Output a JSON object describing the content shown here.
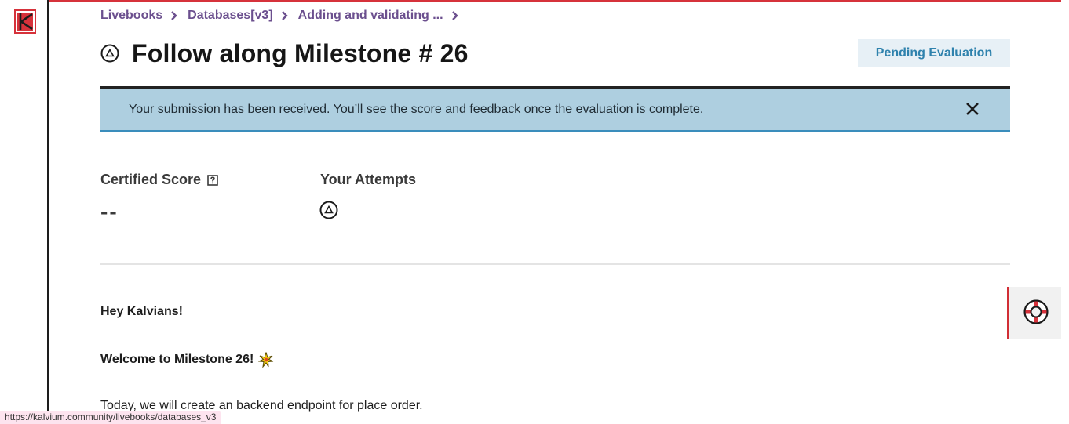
{
  "breadcrumb": {
    "items": [
      "Livebooks",
      "Databases[v3]",
      "Adding and validating ..."
    ]
  },
  "header": {
    "title": "Follow along Milestone # 26",
    "status": "Pending Evaluation"
  },
  "alert": {
    "message": "Your submission has been received. You’ll see the score and feedback once the evaluation is complete."
  },
  "score": {
    "label": "Certified Score",
    "value": "--"
  },
  "attempts": {
    "label": "Your Attempts"
  },
  "body": {
    "greeting": "Hey Kalvians!",
    "welcome": "Welcome to Milestone 26!",
    "intro": "Today, we will create an backend endpoint for place order."
  },
  "status_bar": {
    "url": "https://kalvium.community/livebooks/databases_v3"
  },
  "colors": {
    "accent_red": "#d6323b",
    "breadcrumb_purple": "#6b4f8e",
    "status_blue": "#2f82ad",
    "alert_bg": "#aecfe0"
  },
  "icons": {
    "logo": "kalvium-logo-icon",
    "title_status": "pending-triangle-icon",
    "alert_close": "close-icon",
    "help": "help-square-icon",
    "attempt": "pending-triangle-icon",
    "welcome": "sparkle-emoji-icon",
    "support": "lifebuoy-icon"
  }
}
